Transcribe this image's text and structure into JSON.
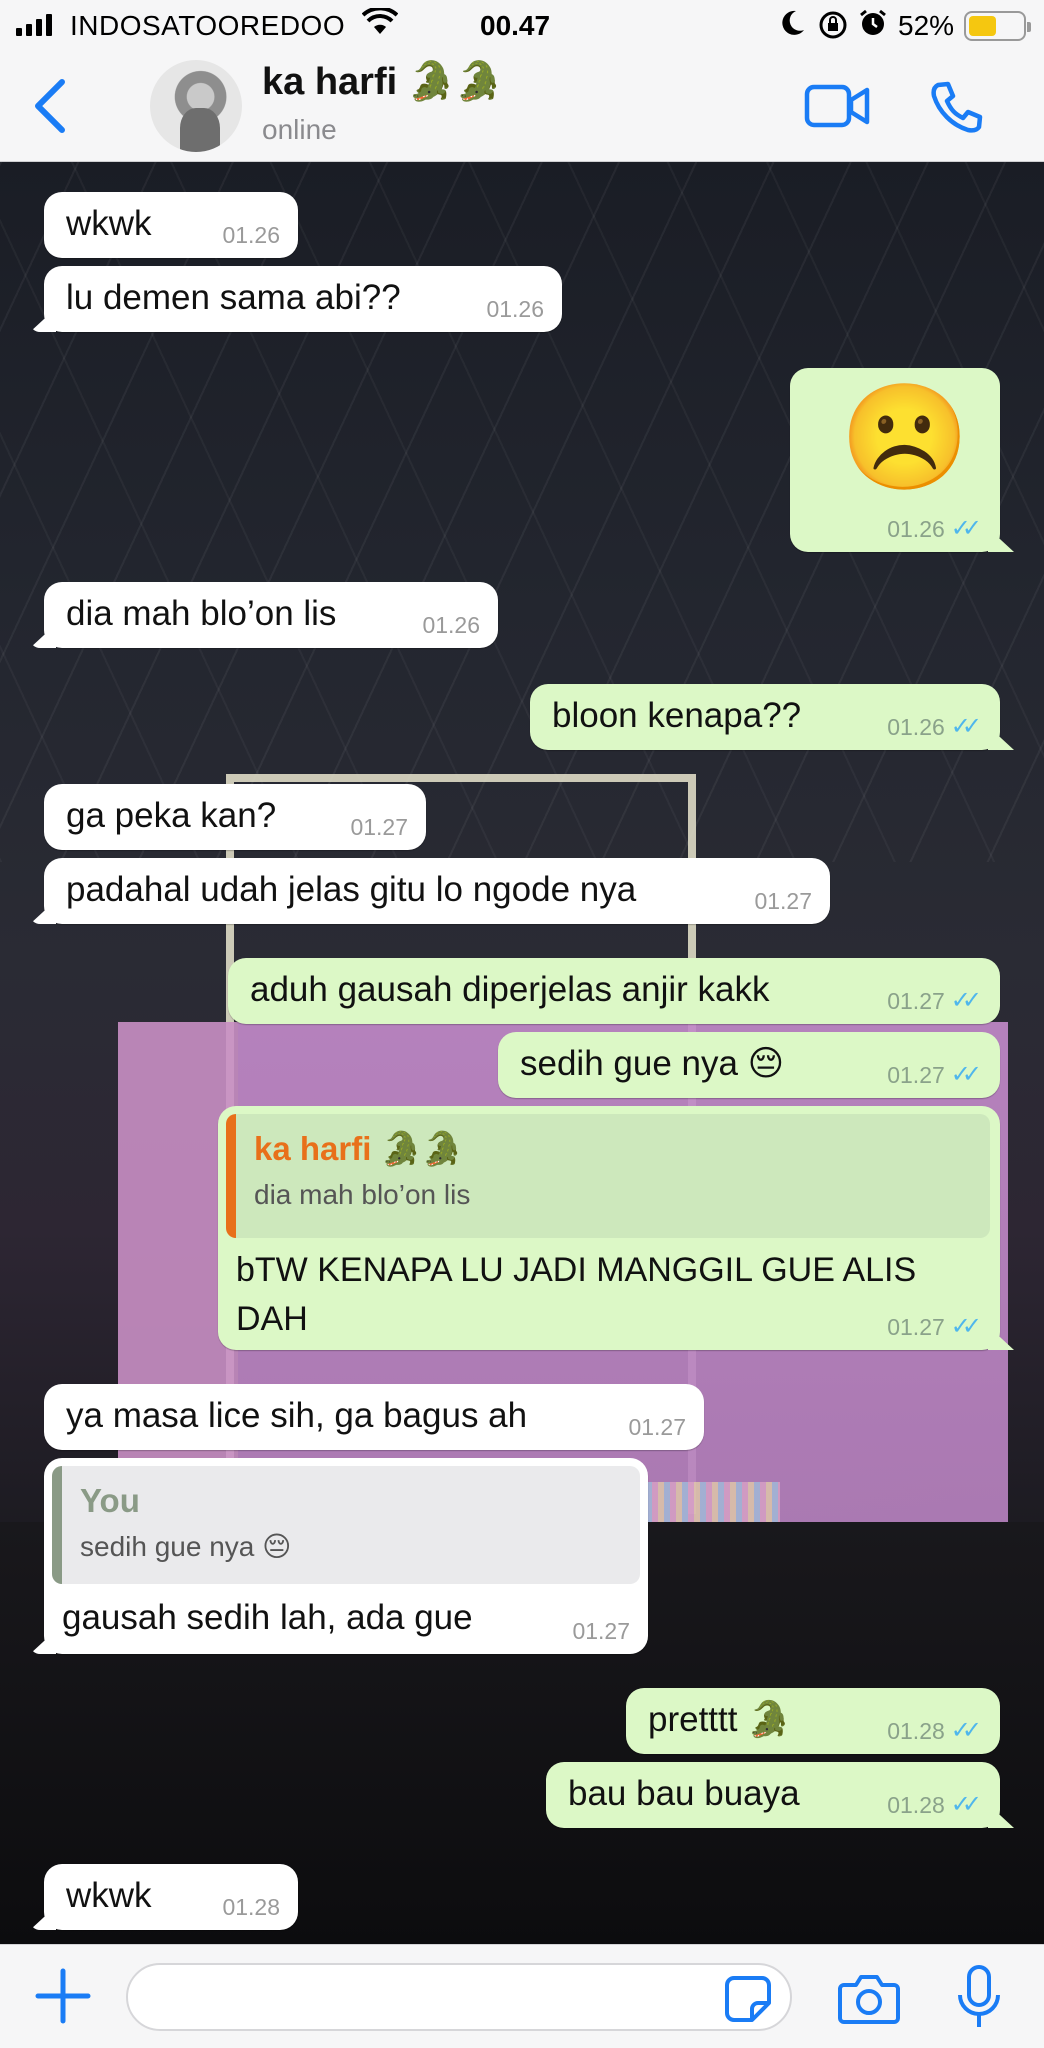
{
  "status_bar": {
    "carrier": "INDOSATOOREDOO",
    "time": "00.47",
    "battery_percent": "52%",
    "battery_level": 0.52,
    "icons": [
      "signal-icon",
      "wifi-icon",
      "moon-icon",
      "rotation-lock-icon",
      "alarm-icon",
      "battery-icon"
    ]
  },
  "header": {
    "back_icon": "chevron-left-icon",
    "contact_name": "ka harfi 🐊🐊",
    "contact_status": "online",
    "video_icon": "video-camera-icon",
    "call_icon": "phone-icon",
    "accent_color": "#1a7cf5"
  },
  "messages": [
    {
      "dir": "in",
      "text": "wkwk",
      "time": "01.26"
    },
    {
      "dir": "in",
      "text": "lu demen sama abi??",
      "time": "01.26"
    },
    {
      "dir": "out",
      "text": "☹️",
      "time": "01.26"
    },
    {
      "dir": "in",
      "text": "dia mah blo’on lis",
      "time": "01.26"
    },
    {
      "dir": "out",
      "text": "bloon kenapa??",
      "time": "01.26"
    },
    {
      "dir": "in",
      "text": "ga peka kan?",
      "time": "01.27"
    },
    {
      "dir": "in",
      "text": "padahal udah jelas gitu lo ngode nya",
      "time": "01.27"
    },
    {
      "dir": "out",
      "text": "aduh gausah diperjelas anjir kakk",
      "time": "01.27"
    },
    {
      "dir": "out",
      "text": "sedih gue nya 😔",
      "time": "01.27"
    },
    {
      "dir": "out",
      "text": "bTW KENAPA LU JADI MANGGIL GUE ALIS DAH",
      "time": "01.27",
      "quote": {
        "name": "ka harfi 🐊🐊",
        "text": "dia mah blo’on lis"
      }
    },
    {
      "dir": "in",
      "text": "ya masa lice sih, ga bagus ah",
      "time": "01.27"
    },
    {
      "dir": "in",
      "text": "gausah sedih lah, ada gue",
      "time": "01.27",
      "quote": {
        "name": "You",
        "text": "sedih gue nya 😔"
      }
    },
    {
      "dir": "out",
      "text": "pretttt 🐊",
      "time": "01.28"
    },
    {
      "dir": "out",
      "text": "bau bau buaya",
      "time": "01.28"
    },
    {
      "dir": "in",
      "text": "wkwk",
      "time": "01.28"
    }
  ],
  "ticks": "✓✓",
  "colors": {
    "incoming_bubble": "#ffffff",
    "outgoing_bubble": "#dcf8c6",
    "read_ticks": "#4fb6ec",
    "quote_contact_name": "#e8701a",
    "quote_you_name": "#8a9a86"
  },
  "composer": {
    "plus_icon": "plus-icon",
    "sticker_icon": "sticker-icon",
    "camera_icon": "camera-icon",
    "mic_icon": "microphone-icon",
    "input_value": ""
  }
}
